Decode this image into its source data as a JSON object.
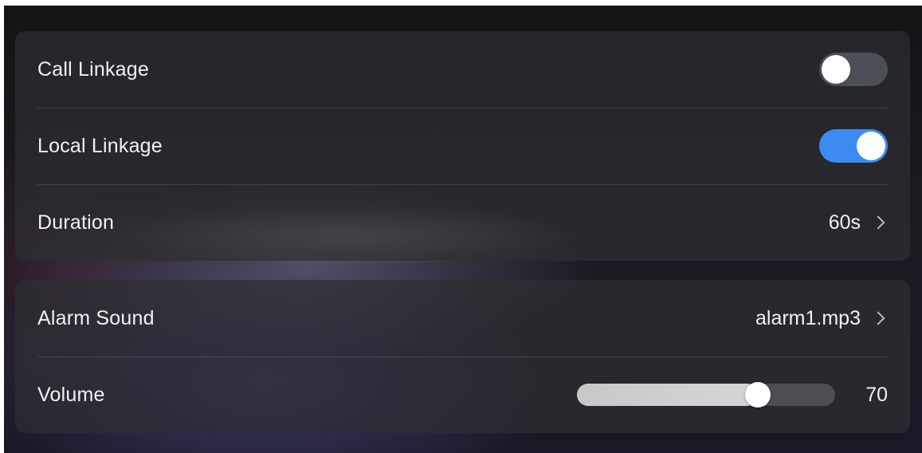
{
  "linkage_card": {
    "call_linkage": {
      "label": "Call Linkage",
      "enabled": false
    },
    "local_linkage": {
      "label": "Local Linkage",
      "enabled": true
    },
    "duration": {
      "label": "Duration",
      "value": "60s"
    }
  },
  "sound_card": {
    "alarm_sound": {
      "label": "Alarm Sound",
      "value": "alarm1.mp3"
    },
    "volume": {
      "label": "Volume",
      "value": "70",
      "level_fraction": 0.7
    }
  },
  "colors": {
    "toggle_on": "#3d8bf2",
    "toggle_off": "#4a4f58",
    "text": "#f2f2f2"
  },
  "icons": [
    "chevron-right-icon"
  ]
}
